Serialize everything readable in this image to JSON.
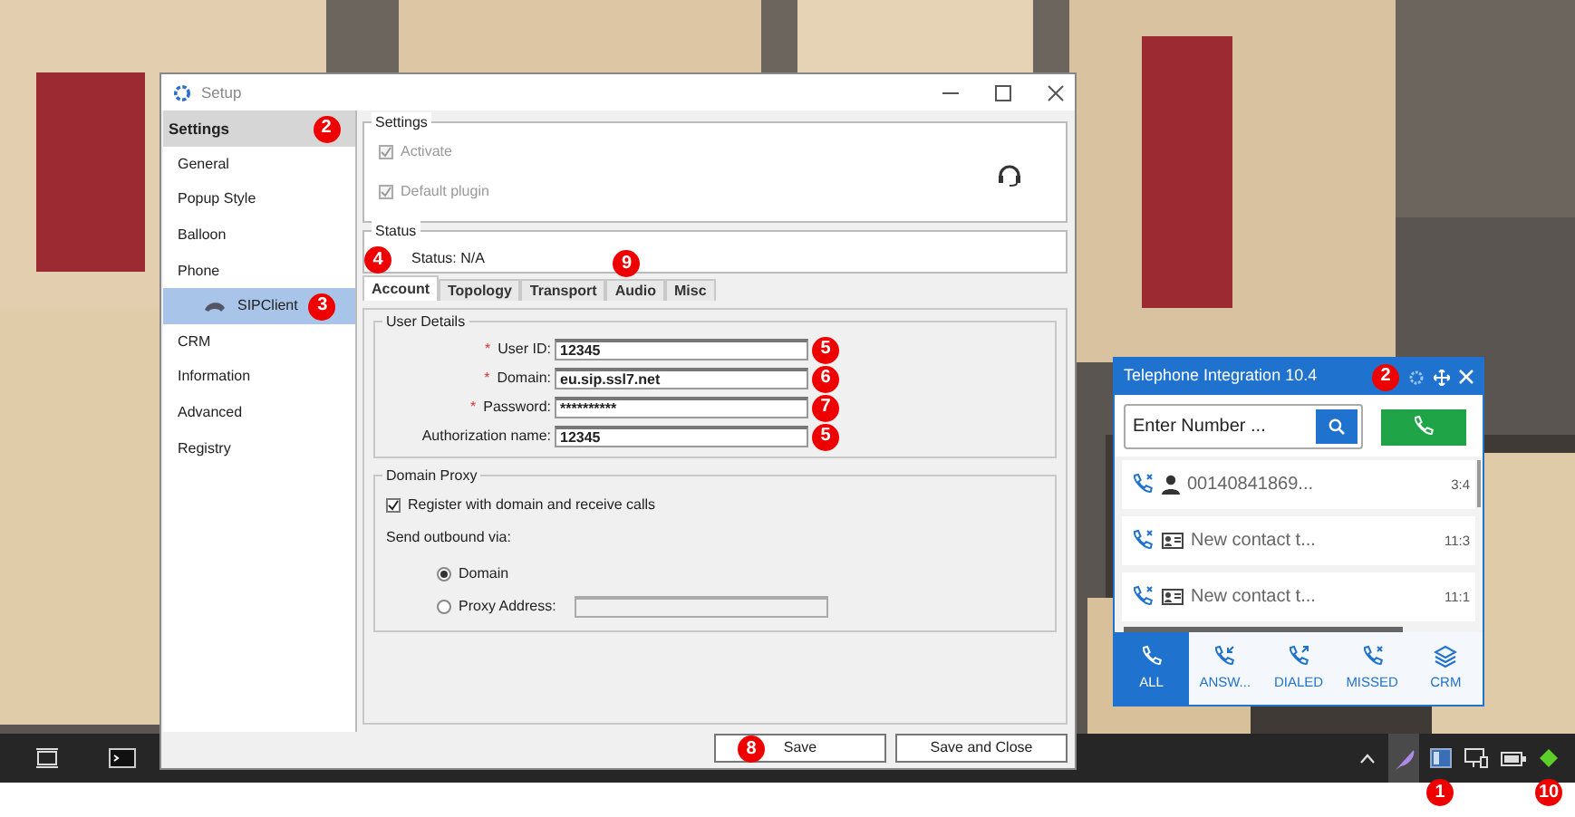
{
  "setup_window": {
    "title": "Setup",
    "sidebar": {
      "header": "Settings",
      "badge": "2",
      "items": [
        {
          "label": "General",
          "selected": false
        },
        {
          "label": "Popup Style",
          "selected": false
        },
        {
          "label": "Balloon",
          "selected": false
        },
        {
          "label": "Phone",
          "selected": false,
          "children": [
            {
              "label": "SIPClient",
              "selected": true,
              "badge": "3"
            }
          ]
        },
        {
          "label": "CRM",
          "selected": false
        },
        {
          "label": "Information",
          "selected": false
        },
        {
          "label": "Advanced",
          "selected": false
        },
        {
          "label": "Registry",
          "selected": false
        }
      ]
    },
    "settings_group": {
      "title": "Settings",
      "checkboxes": [
        {
          "label": "Activate",
          "checked": true,
          "disabled": true
        },
        {
          "label": "Default plugin",
          "checked": true,
          "disabled": true
        }
      ]
    },
    "status_group": {
      "title": "Status",
      "text": "Status: N/A"
    },
    "tabs": [
      {
        "label": "Account",
        "selected": true,
        "badge": "4"
      },
      {
        "label": "Topology",
        "selected": false
      },
      {
        "label": "Transport",
        "selected": false
      },
      {
        "label": "Audio",
        "selected": false,
        "badge": "9"
      },
      {
        "label": "Misc",
        "selected": false
      }
    ],
    "user_details": {
      "title": "User Details",
      "fields": [
        {
          "marker": "*",
          "label": "User ID:",
          "value": "12345",
          "badge": "5"
        },
        {
          "marker": "*",
          "label": "Domain:",
          "value": "eu.sip.ssl7.net",
          "badge": "6"
        },
        {
          "marker": "*",
          "label": "Password:",
          "value": "**********",
          "badge": "7"
        },
        {
          "label": "Authorization name:",
          "value": "12345",
          "badge": "5"
        }
      ]
    },
    "domain_proxy": {
      "title": "Domain Proxy",
      "register": {
        "label": "Register with domain and receive calls",
        "checked": true
      },
      "outbound_label": "Send outbound via:",
      "options": [
        {
          "label": "Domain",
          "selected": true,
          "kind": "plain"
        },
        {
          "label": "Proxy Address:",
          "selected": false,
          "kind": "field"
        }
      ]
    },
    "buttons": [
      {
        "label": "Save",
        "badge": "8"
      },
      {
        "label": "Save and Close"
      }
    ]
  },
  "phone_widget": {
    "title": "Telephone Integration 10.4",
    "badge": "2",
    "search": {
      "placeholder": "Enter Number ..."
    },
    "calls": [
      {
        "kind": "person",
        "text": "00140841869...",
        "time": "3:4"
      },
      {
        "kind": "contact",
        "text": "New contact t...",
        "time": "11:3"
      },
      {
        "kind": "contact",
        "text": "New contact t...",
        "time": "11:1"
      }
    ],
    "nav": [
      {
        "label": "ALL",
        "selected": true
      },
      {
        "label": "ANSW...",
        "selected": false
      },
      {
        "label": "DIALED",
        "selected": false
      },
      {
        "label": "MISSED",
        "selected": false
      },
      {
        "label": "CRM",
        "selected": false
      }
    ]
  },
  "taskbar": {
    "tray_icons": [
      {
        "highlighted": false
      },
      {
        "highlighted": true
      },
      {
        "highlighted": false,
        "badge": "1"
      },
      {
        "highlighted": false
      },
      {
        "highlighted": false
      },
      {
        "highlighted": false,
        "badge": "10"
      }
    ]
  }
}
